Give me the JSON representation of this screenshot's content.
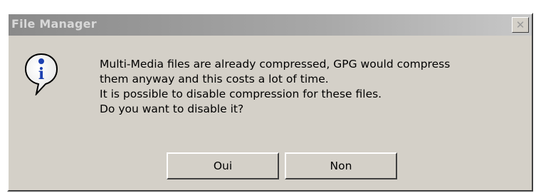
{
  "window": {
    "title": "File Manager",
    "close_glyph": "✕"
  },
  "icon": {
    "name": "info-icon",
    "glyph": "i"
  },
  "message": {
    "lines": [
      "Multi-Media files are already compressed, GPG would compress",
      "them anyway and this costs a lot of time.",
      "It is possible to disable compression for these files.",
      "Do you want to disable it?"
    ]
  },
  "buttons": {
    "yes_label": "Oui",
    "no_label": "Non"
  },
  "colors": {
    "dialog_face": "#d4d0c8",
    "titlebar_inactive": "#8a8a8a",
    "info_blue": "#1b3fb0"
  }
}
